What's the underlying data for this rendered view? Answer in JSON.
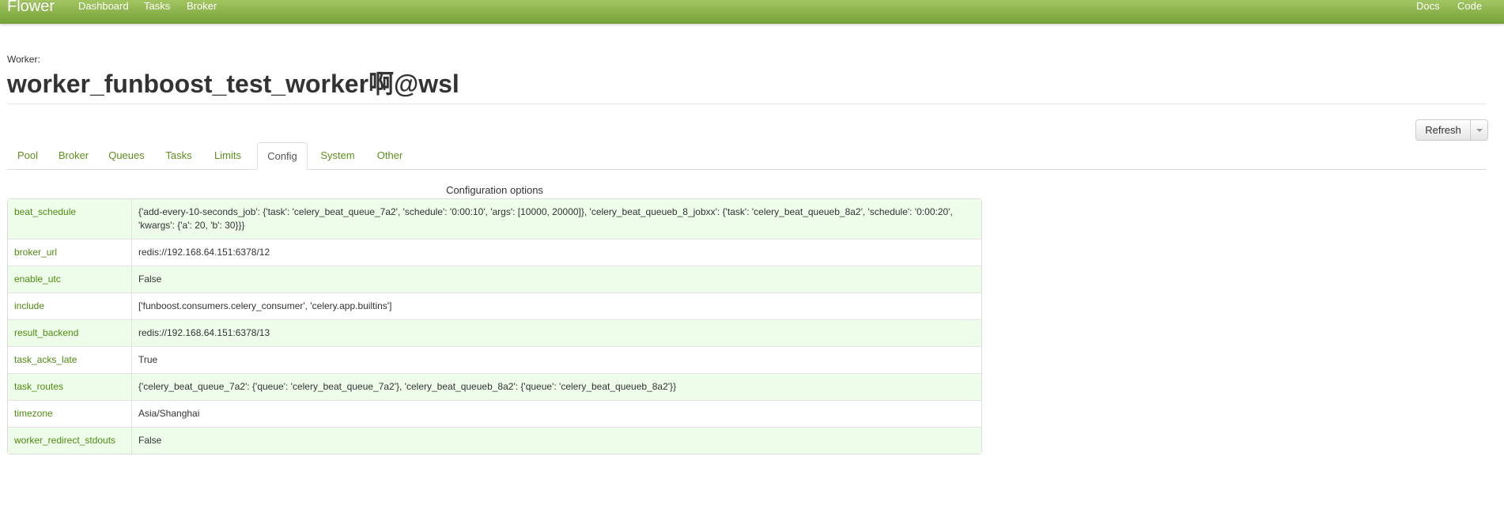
{
  "navbar": {
    "brand": "Flower",
    "links": [
      "Dashboard",
      "Tasks",
      "Broker"
    ],
    "right_links": [
      "Docs",
      "Code"
    ]
  },
  "header": {
    "label": "Worker:",
    "title": "worker_funboost_test_worker啊@wsl"
  },
  "toolbar": {
    "refresh_label": "Refresh"
  },
  "tabs": [
    "Pool",
    "Broker",
    "Queues",
    "Tasks",
    "Limits",
    "Config",
    "System",
    "Other"
  ],
  "active_tab": "Config",
  "config": {
    "caption": "Configuration options",
    "rows": [
      {
        "key": "beat_schedule",
        "value": "{'add-every-10-seconds_job': {'task': 'celery_beat_queue_7a2', 'schedule': '0:00:10', 'args': [10000, 20000]}, 'celery_beat_queueb_8_jobxx': {'task': 'celery_beat_queueb_8a2', 'schedule': '0:00:20', 'kwargs': {'a': 20, 'b': 30}}}"
      },
      {
        "key": "broker_url",
        "value": "redis://192.168.64.151:6378/12"
      },
      {
        "key": "enable_utc",
        "value": "False"
      },
      {
        "key": "include",
        "value": "['funboost.consumers.celery_consumer', 'celery.app.builtins']"
      },
      {
        "key": "result_backend",
        "value": "redis://192.168.64.151:6378/13"
      },
      {
        "key": "task_acks_late",
        "value": "True"
      },
      {
        "key": "task_routes",
        "value": "{'celery_beat_queue_7a2': {'queue': 'celery_beat_queue_7a2'}, 'celery_beat_queueb_8a2': {'queue': 'celery_beat_queueb_8a2'}}"
      },
      {
        "key": "timezone",
        "value": "Asia/Shanghai"
      },
      {
        "key": "worker_redirect_stdouts",
        "value": "False"
      }
    ]
  },
  "colors": {
    "navbar_top": "#a2c562",
    "navbar_bottom": "#78a33a",
    "link_green": "#5e8e1d",
    "row_highlight": "#edfdea"
  }
}
